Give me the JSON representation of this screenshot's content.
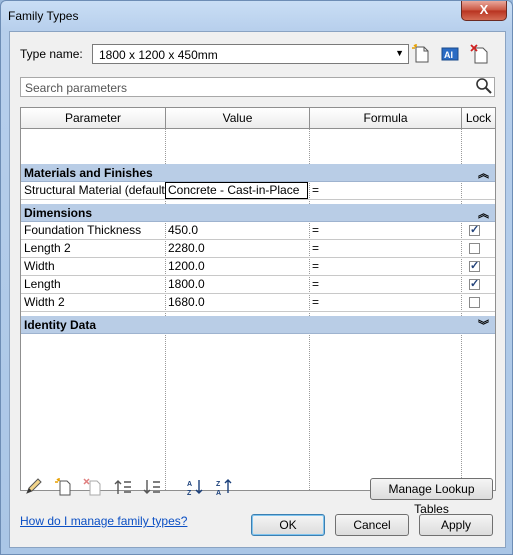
{
  "window": {
    "title": "Family Types",
    "close_glyph": "X"
  },
  "type_name": {
    "label": "Type name:",
    "value": "1800 x 1200 x 450mm"
  },
  "search": {
    "placeholder": "Search parameters"
  },
  "table": {
    "headers": [
      "Parameter",
      "Value",
      "Formula",
      "Lock"
    ],
    "groups": [
      {
        "name": "Materials and Finishes",
        "state": "expanded",
        "rows": [
          {
            "parameter": "Structural Material (default)",
            "value": "Concrete - Cast-in-Place",
            "formula": "=",
            "lock": null,
            "editing": true
          }
        ]
      },
      {
        "name": "Dimensions",
        "state": "expanded",
        "rows": [
          {
            "parameter": "Foundation Thickness",
            "value": "450.0",
            "formula": "=",
            "lock": true
          },
          {
            "parameter": "Length 2",
            "value": "2280.0",
            "formula": "=",
            "lock": false
          },
          {
            "parameter": "Width",
            "value": "1200.0",
            "formula": "=",
            "lock": true
          },
          {
            "parameter": "Length",
            "value": "1800.0",
            "formula": "=",
            "lock": true
          },
          {
            "parameter": "Width 2",
            "value": "1680.0",
            "formula": "=",
            "lock": false
          }
        ]
      },
      {
        "name": "Identity Data",
        "state": "collapsed",
        "rows": []
      }
    ]
  },
  "toolbar_icons": [
    "edit-parameter-icon",
    "new-parameter-icon",
    "delete-parameter-icon",
    "move-up-icon",
    "move-down-icon",
    "sort-ascending-icon",
    "sort-descending-icon"
  ],
  "buttons": {
    "manage_lookup": "Manage Lookup Tables",
    "ok": "OK",
    "cancel": "Cancel",
    "apply": "Apply"
  },
  "help_link": "How do I manage family types?",
  "colors": {
    "group_header": "#b9cde6",
    "link": "#0b4fc4",
    "title_bar": "#b7cfec"
  }
}
